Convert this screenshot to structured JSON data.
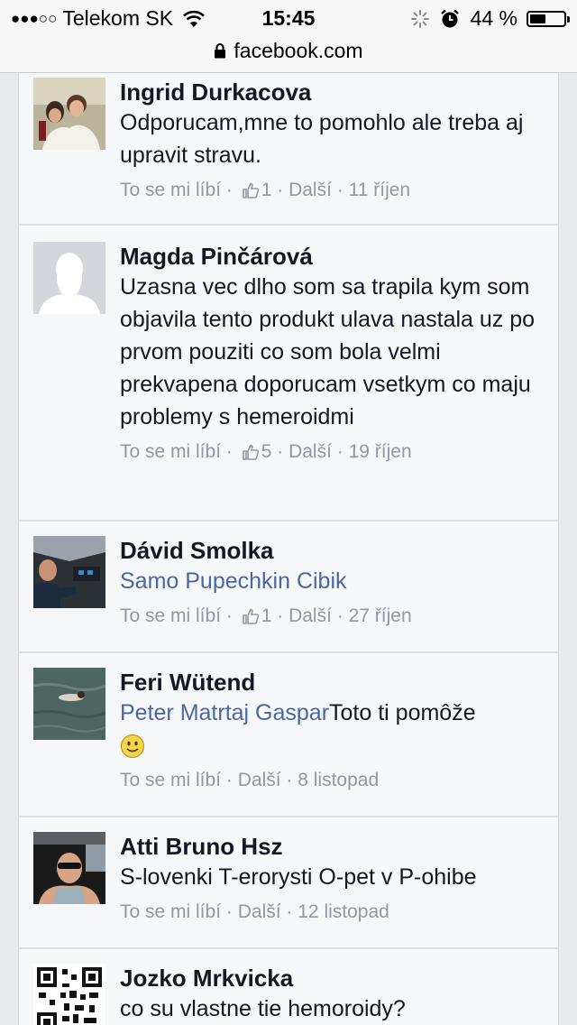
{
  "status_bar": {
    "signal_dots": "●●●○○",
    "carrier": "Telekom SK",
    "time": "15:45",
    "battery_percent": "44 %",
    "battery_level": 0.44
  },
  "address_bar": {
    "url": "facebook.com"
  },
  "like_label": "To se mi líbí",
  "more_label": "Další",
  "separator": " · ",
  "comments": [
    {
      "name": "Ingrid Durkacova",
      "mention": "",
      "text": "Odporucam,mne to pomohlo ale treba aj upravit stravu.",
      "likes": "1",
      "date": "11 říjen"
    },
    {
      "name": "Magda Pinčárová",
      "mention": "",
      "text": "Uzasna vec dlho som sa trapila kym som objavila tento produkt ulava nastala uz po prvom pouziti co som bola velmi prekvapena doporucam vsetkym co maju problemy s hemeroidmi",
      "likes": "5",
      "date": "19 říjen"
    },
    {
      "name": "Dávid Smolka",
      "mention": "Samo Pupechkin Cibik",
      "text": "",
      "likes": "1",
      "date": "27 říjen"
    },
    {
      "name": "Feri Wütend",
      "mention": "Peter Matrtaj Gaspar",
      "text": "Toto ti pomôže",
      "likes": "",
      "date": "8 listopad"
    },
    {
      "name": "Atti Bruno Hsz",
      "mention": "",
      "text": "S-lovenki T-erorysti O-pet v P-ohibe",
      "likes": "",
      "date": "12 listopad"
    },
    {
      "name": "Jozko Mrkvicka",
      "mention": "",
      "text": "co su vlastne tie hemoroidy?",
      "likes": "",
      "date": ""
    }
  ]
}
